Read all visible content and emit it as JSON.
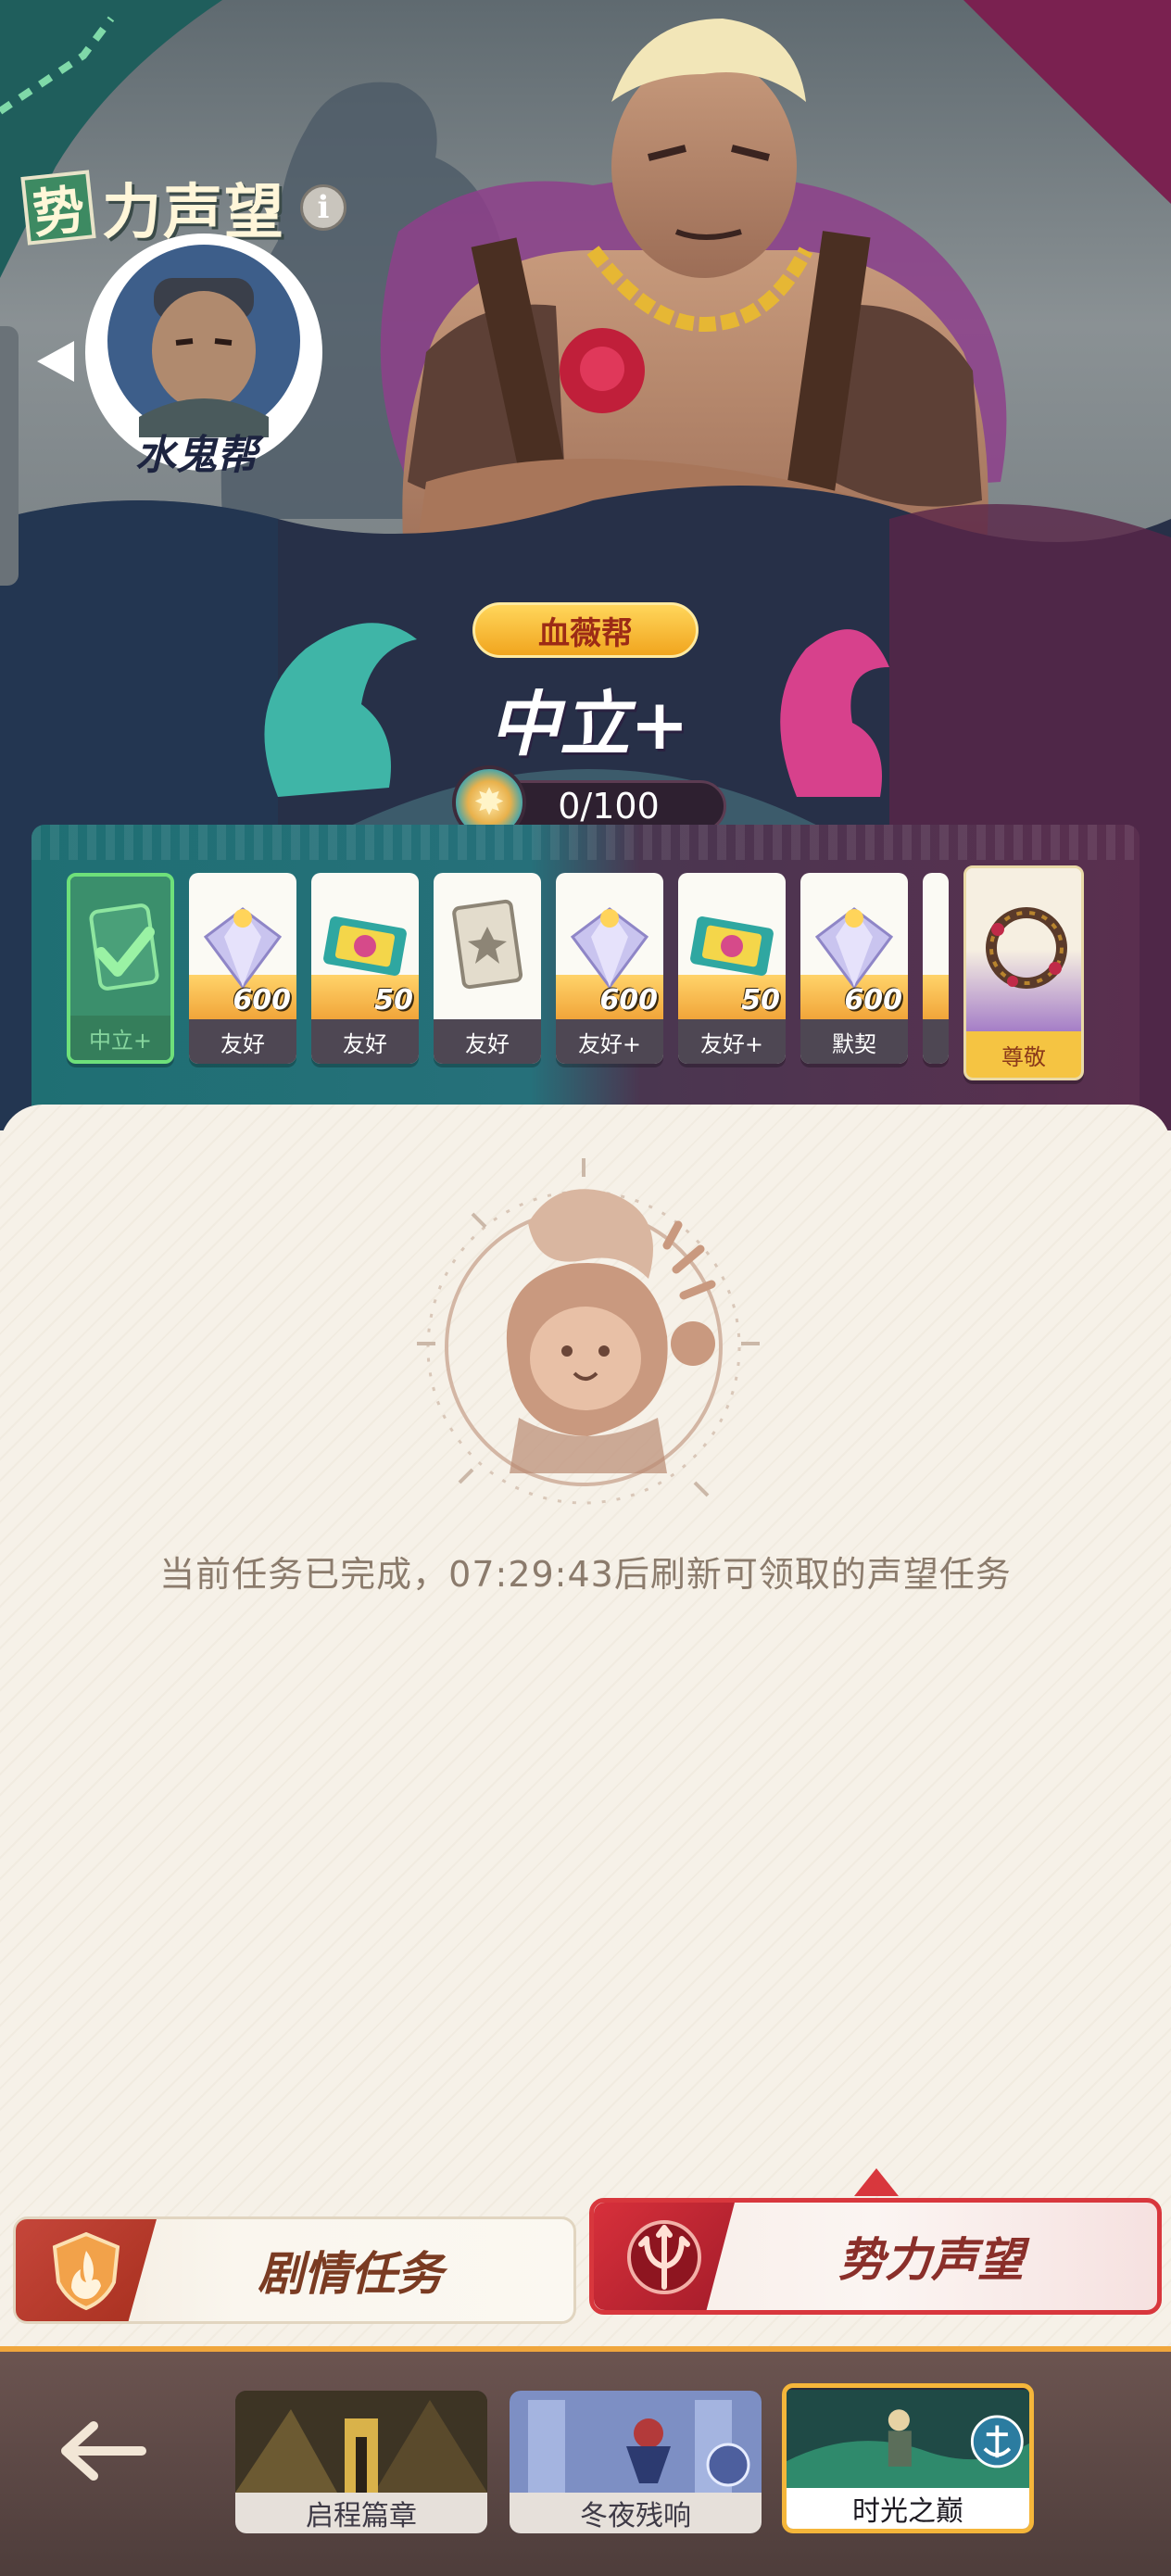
{
  "header": {
    "title_badge": "势",
    "title": "力声望",
    "info_label": "i"
  },
  "npc": {
    "name": "水鬼帮"
  },
  "faction": {
    "name": "血薇帮",
    "level": "中立+",
    "progress": "0/100",
    "progress_value": 0,
    "progress_max": 100
  },
  "rewards": [
    {
      "level": "中立+",
      "amount": "",
      "item": "card-icon",
      "claimed": true
    },
    {
      "level": "友好",
      "amount": "600",
      "item": "diamond-icon",
      "claimed": false
    },
    {
      "level": "友好",
      "amount": "50",
      "item": "ticket-icon",
      "claimed": false
    },
    {
      "level": "友好",
      "amount": "",
      "item": "card-icon",
      "claimed": false
    },
    {
      "level": "友好+",
      "amount": "600",
      "item": "diamond-icon",
      "claimed": false
    },
    {
      "level": "友好+",
      "amount": "50",
      "item": "ticket-icon",
      "claimed": false
    },
    {
      "level": "默契",
      "amount": "600",
      "item": "diamond-icon",
      "claimed": false
    },
    {
      "level": "尊敬",
      "amount": "",
      "item": "wreath-icon",
      "claimed": false
    }
  ],
  "status": {
    "message": "当前任务已完成，07:29:43后刷新可领取的声望任务"
  },
  "tabs": [
    {
      "label": "剧情任务",
      "active": false
    },
    {
      "label": "势力声望",
      "active": true
    }
  ],
  "chapters": [
    {
      "label": "启程篇章",
      "selected": false
    },
    {
      "label": "冬夜残响",
      "selected": false
    },
    {
      "label": "时光之巅",
      "selected": true
    }
  ],
  "colors": {
    "accent_red": "#d8373d",
    "gold": "#f5b63a",
    "teal": "#1f6f73",
    "claimed_green": "#6ee07a"
  }
}
